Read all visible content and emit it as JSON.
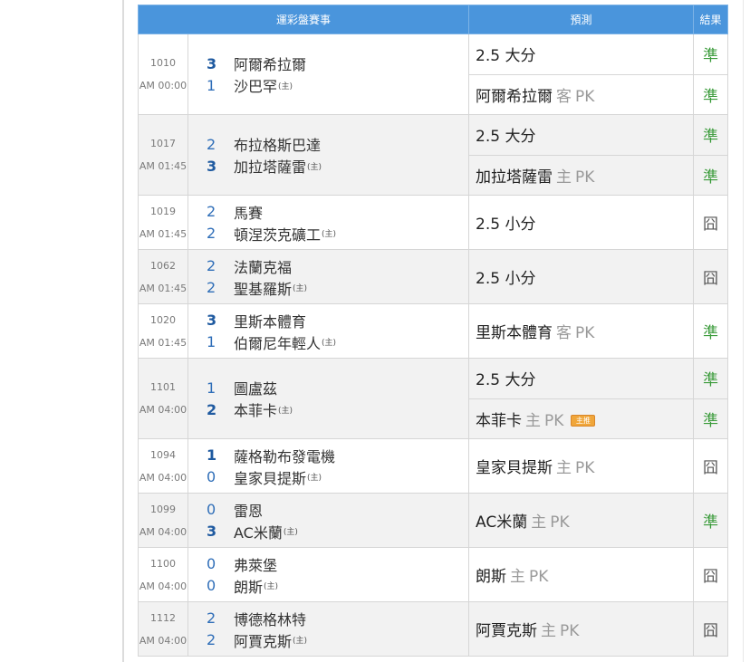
{
  "header": {
    "col_match": "運彩盤賽事",
    "col_pred": "預測",
    "col_result": "結果"
  },
  "home_mark": "(主)",
  "matches": [
    {
      "id": "1010",
      "time": "AM 00:00",
      "away": {
        "score": "3",
        "name": "阿爾希拉爾"
      },
      "home": {
        "score": "1",
        "name": "沙巴罕"
      },
      "preds": [
        {
          "main": "2.5 大分",
          "side": "",
          "pk": "",
          "tag": "",
          "result": "準"
        },
        {
          "main": "阿爾希拉爾",
          "side": "客",
          "pk": "PK",
          "tag": "",
          "result": "準"
        }
      ]
    },
    {
      "id": "1017",
      "time": "AM 01:45",
      "away": {
        "score": "2",
        "name": "布拉格斯巴達"
      },
      "home": {
        "score": "3",
        "name": "加拉塔薩雷"
      },
      "preds": [
        {
          "main": "2.5 大分",
          "side": "",
          "pk": "",
          "tag": "",
          "result": "準"
        },
        {
          "main": "加拉塔薩雷",
          "side": "主",
          "pk": "PK",
          "tag": "",
          "result": "準"
        }
      ]
    },
    {
      "id": "1019",
      "time": "AM 01:45",
      "away": {
        "score": "2",
        "name": "馬賽"
      },
      "home": {
        "score": "2",
        "name": "頓涅茨克礦工"
      },
      "preds": [
        {
          "main": "2.5 小分",
          "side": "",
          "pk": "",
          "tag": "",
          "result": "囧"
        }
      ]
    },
    {
      "id": "1062",
      "time": "AM 01:45",
      "away": {
        "score": "2",
        "name": "法蘭克福"
      },
      "home": {
        "score": "2",
        "name": "聖基羅斯"
      },
      "preds": [
        {
          "main": "2.5 小分",
          "side": "",
          "pk": "",
          "tag": "",
          "result": "囧"
        }
      ]
    },
    {
      "id": "1020",
      "time": "AM 01:45",
      "away": {
        "score": "3",
        "name": "里斯本體育"
      },
      "home": {
        "score": "1",
        "name": "伯爾尼年輕人"
      },
      "preds": [
        {
          "main": "里斯本體育",
          "side": "客",
          "pk": "PK",
          "tag": "",
          "result": "準"
        }
      ]
    },
    {
      "id": "1101",
      "time": "AM 04:00",
      "away": {
        "score": "1",
        "name": "圖盧茲"
      },
      "home": {
        "score": "2",
        "name": "本菲卡"
      },
      "preds": [
        {
          "main": "2.5 大分",
          "side": "",
          "pk": "",
          "tag": "",
          "result": "準"
        },
        {
          "main": "本菲卡",
          "side": "主",
          "pk": "PK",
          "tag": "主推",
          "result": "準"
        }
      ]
    },
    {
      "id": "1094",
      "time": "AM 04:00",
      "away": {
        "score": "1",
        "name": "薩格勒布發電機"
      },
      "home": {
        "score": "0",
        "name": "皇家貝提斯"
      },
      "preds": [
        {
          "main": "皇家貝提斯",
          "side": "主",
          "pk": "PK",
          "tag": "",
          "result": "囧"
        }
      ]
    },
    {
      "id": "1099",
      "time": "AM 04:00",
      "away": {
        "score": "0",
        "name": "雷恩"
      },
      "home": {
        "score": "3",
        "name": "AC米蘭"
      },
      "preds": [
        {
          "main": "AC米蘭",
          "side": "主",
          "pk": "PK",
          "tag": "",
          "result": "準"
        }
      ]
    },
    {
      "id": "1100",
      "time": "AM 04:00",
      "away": {
        "score": "0",
        "name": "弗萊堡"
      },
      "home": {
        "score": "0",
        "name": "朗斯"
      },
      "preds": [
        {
          "main": "朗斯",
          "side": "主",
          "pk": "PK",
          "tag": "",
          "result": "囧"
        }
      ]
    },
    {
      "id": "1112",
      "time": "AM 04:00",
      "away": {
        "score": "2",
        "name": "博德格林特"
      },
      "home": {
        "score": "2",
        "name": "阿賈克斯"
      },
      "preds": [
        {
          "main": "阿賈克斯",
          "side": "主",
          "pk": "PK",
          "tag": "",
          "result": "囧"
        }
      ]
    }
  ]
}
